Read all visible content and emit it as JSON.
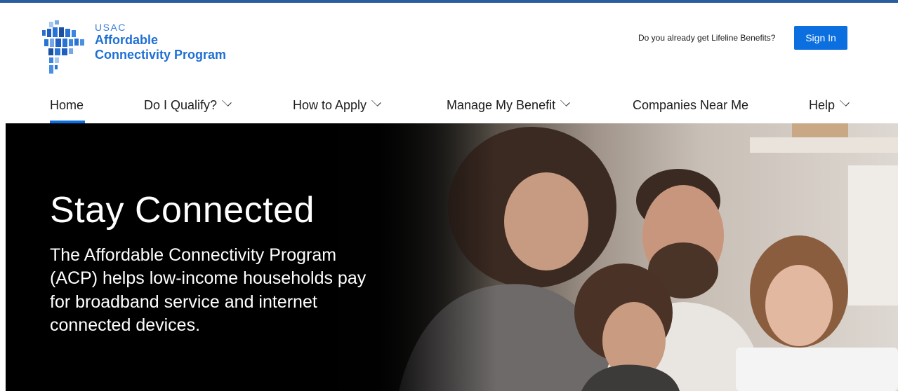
{
  "brand": {
    "org": "USAC",
    "name_line1": "Affordable",
    "name_line2": "Connectivity Program"
  },
  "header": {
    "lifeline_question": "Do you already get Lifeline Benefits?",
    "sign_in_label": "Sign In"
  },
  "nav": {
    "home": "Home",
    "qualify": "Do I Qualify?",
    "apply": "How to Apply",
    "manage": "Manage My Benefit",
    "companies": "Companies Near Me",
    "help": "Help"
  },
  "hero": {
    "title": "Stay Connected",
    "description": "The Affordable Connectivity Program (ACP) helps low-income households pay for broadband service and internet connected devices."
  },
  "colors": {
    "accent": "#0b6fe0",
    "brand_blue": "#1f6fd4",
    "top_border": "#2a5d9f"
  },
  "icons": {
    "logo_mark": "usac-map-logo",
    "dropdown": "chevron-down-icon"
  }
}
